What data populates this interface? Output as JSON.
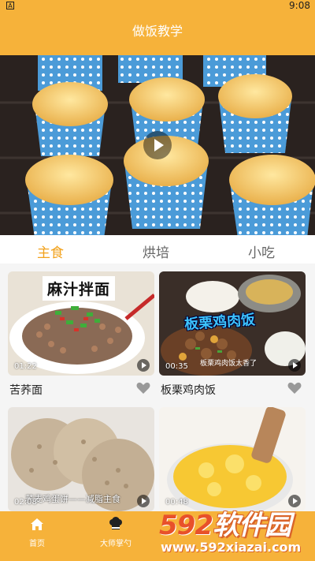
{
  "status_bar": {
    "app_badge": "A",
    "time": "9:08"
  },
  "header": {
    "title": "做饭教学"
  },
  "tabs": [
    {
      "label": "主食",
      "active": true
    },
    {
      "label": "烘培",
      "active": false
    },
    {
      "label": "小吃",
      "active": false
    }
  ],
  "recipes": [
    {
      "title": "苦荞面",
      "duration": "01:22",
      "overlay_title": "麻汁拌面",
      "overlay_sub": ""
    },
    {
      "title": "板栗鸡肉饭",
      "duration": "00:35",
      "overlay_title": "板栗鸡肉饭",
      "overlay_sub": "板栗鸡肉饭太香了"
    },
    {
      "title": "",
      "duration": "02:08",
      "overlay_title": "",
      "overlay_sub": "荞麦鸡蛋饼——减脂主食"
    },
    {
      "title": "",
      "duration": "00:48",
      "overlay_title": "",
      "overlay_sub": ""
    }
  ],
  "tabbar": {
    "items": [
      {
        "label": "首页",
        "icon": "home-icon",
        "active": false
      },
      {
        "label": "大师掌勺",
        "icon": "chef-hat-icon",
        "active": true
      }
    ]
  },
  "watermark": {
    "brand_num": "592",
    "brand_text": "软件园",
    "url": "www.592xiazai.com"
  },
  "colors": {
    "primary": "#f6b23a",
    "accent": "#f2a21c",
    "text": "#222222"
  }
}
